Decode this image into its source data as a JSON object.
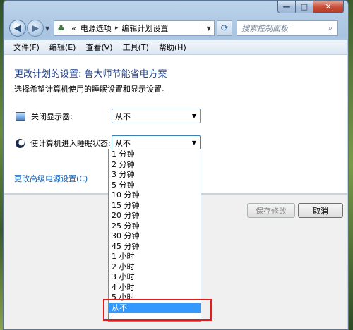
{
  "window": {
    "caption_min": "—",
    "caption_max": "□",
    "caption_close": "✕"
  },
  "address_bar": {
    "prefix": "«",
    "crumb1": "电源选项",
    "crumb2": "编辑计划设置",
    "arrow": "▸"
  },
  "search": {
    "placeholder": "搜索控制面板"
  },
  "menu": [
    "文件(F)",
    "编辑(E)",
    "查看(V)",
    "工具(T)",
    "帮助(H)"
  ],
  "page": {
    "title": "更改计划的设置: 鲁大师节能省电方案",
    "description": "选择希望计算机使用的睡眠设置和显示设置。",
    "display_label": "关闭显示器:",
    "display_value": "从不",
    "sleep_label": "使计算机进入睡眠状态:",
    "sleep_value": "从不",
    "advanced_link": "更改高级电源设置(C)"
  },
  "buttons": {
    "save": "保存修改",
    "cancel": "取消"
  },
  "dropdown_options": [
    "1 分钟",
    "2 分钟",
    "3 分钟",
    "5 分钟",
    "10 分钟",
    "15 分钟",
    "20 分钟",
    "25 分钟",
    "30 分钟",
    "45 分钟",
    "1 小时",
    "2 小时",
    "3 小时",
    "4 小时",
    "5 小时",
    "从不"
  ],
  "dropdown_selected_index": 15,
  "colors": {
    "title_blue": "#1e3f8a",
    "link_blue": "#0f5fb8",
    "selection_blue": "#3399ff",
    "highlight_red": "#e31b1b"
  }
}
